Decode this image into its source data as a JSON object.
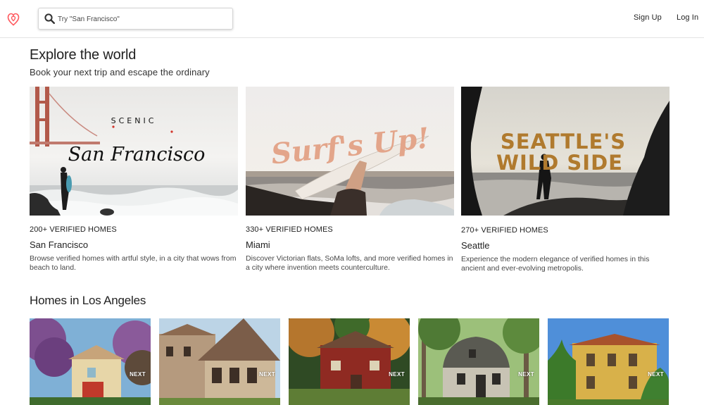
{
  "header": {
    "logo_icon": "airbnb-logo-icon",
    "brand_color": "#FF5A5F",
    "search": {
      "placeholder": "Try \"San Francisco\"",
      "value": "",
      "icon": "search-icon"
    },
    "nav": {
      "signup_label": "Sign Up",
      "login_label": "Log In"
    }
  },
  "explore": {
    "title": "Explore the world",
    "subtitle": "Book your next trip and escape the ordinary",
    "cards": [
      {
        "image_text_top": "SCENIC",
        "image_text_main": "San Francisco",
        "count": "200+ VERIFIED HOMES",
        "city": "San Francisco",
        "description": "Browse verified homes with artful style, in a city that wows from beach to land."
      },
      {
        "image_text_main": "Surf's Up!",
        "count": "330+ VERIFIED HOMES",
        "city": "Miami",
        "description": "Discover Victorian flats, SoMa lofts, and more verified homes in a city where invention meets counterculture."
      },
      {
        "image_text_main": "SEATTLE'S",
        "image_text_sub": "WILD SIDE",
        "count": "270+ VERIFIED HOMES",
        "city": "Seattle",
        "description": "Experience the modern elegance of verified homes in this ancient and ever-evolving metropolis."
      }
    ]
  },
  "homes": {
    "title": "Homes in Los Angeles",
    "next_label": "NEXT"
  }
}
